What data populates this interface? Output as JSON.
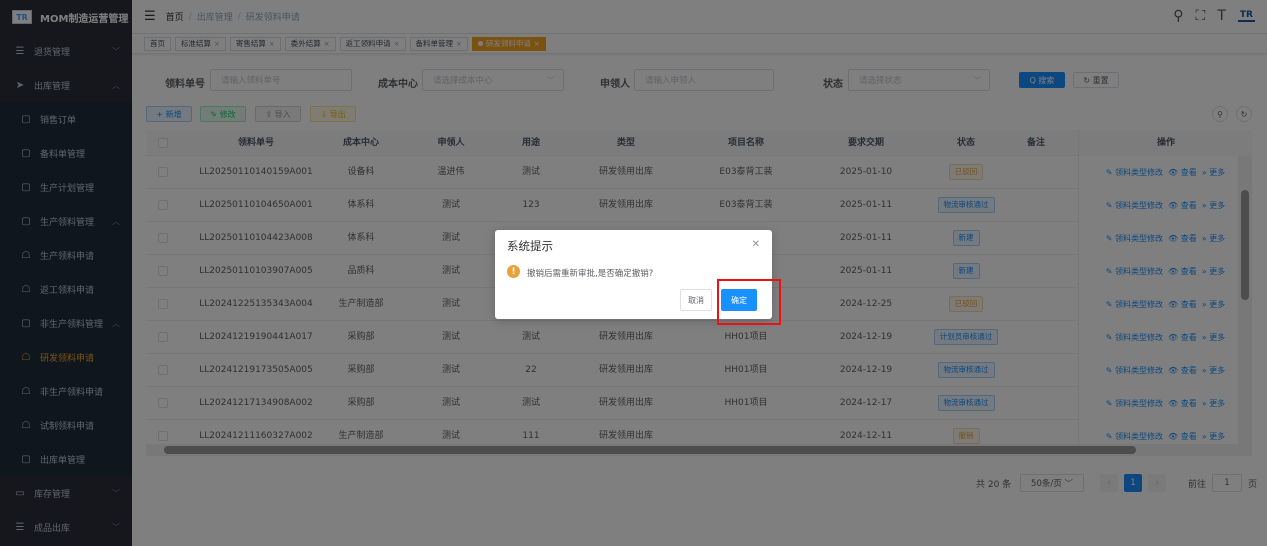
{
  "brand": {
    "logo": "TR",
    "title": "MOM制造运营管理"
  },
  "sidebar": {
    "items": [
      {
        "label": "退货管理",
        "icon": "list-icon",
        "type": "top",
        "chevron": "﹀"
      },
      {
        "label": "出库管理",
        "icon": "send-icon",
        "type": "top-open",
        "chevron": "︿"
      },
      {
        "label": "销售订单",
        "icon": "box-icon",
        "type": "sub"
      },
      {
        "label": "备料单管理",
        "icon": "box-icon",
        "type": "sub"
      },
      {
        "label": "生产计划管理",
        "icon": "box-icon",
        "type": "sub"
      },
      {
        "label": "生产领料管理",
        "icon": "box-icon",
        "type": "sub",
        "chevron": "︿"
      },
      {
        "label": "生产领料申请",
        "icon": "user-icon",
        "type": "sub"
      },
      {
        "label": "返工领料申请",
        "icon": "user-icon",
        "type": "sub"
      },
      {
        "label": "非生产领料管理",
        "icon": "box-icon",
        "type": "sub",
        "chevron": "︿"
      },
      {
        "label": "研发领料申请",
        "icon": "user-icon",
        "type": "sub",
        "active": true
      },
      {
        "label": "非生产领料申请",
        "icon": "user-icon",
        "type": "sub"
      },
      {
        "label": "试制领料申请",
        "icon": "user-icon",
        "type": "sub"
      },
      {
        "label": "出库单管理",
        "icon": "box-icon",
        "type": "sub"
      },
      {
        "label": "库存管理",
        "icon": "monitor-icon",
        "type": "top",
        "chevron": "﹀"
      },
      {
        "label": "成品出库",
        "icon": "list-icon",
        "type": "top",
        "chevron": "﹀"
      }
    ]
  },
  "header": {
    "breadcrumb": [
      "首页",
      "出库管理",
      "研发领料申请"
    ],
    "logo": "TR"
  },
  "tags": [
    {
      "label": "首页",
      "closable": false
    },
    {
      "label": "标准结算",
      "closable": true
    },
    {
      "label": "寄售结算",
      "closable": true
    },
    {
      "label": "委外结算",
      "closable": true
    },
    {
      "label": "返工领料申请",
      "closable": true
    },
    {
      "label": "备料单管理",
      "closable": true
    },
    {
      "label": "研发领料申请",
      "closable": true,
      "active": true
    }
  ],
  "search": {
    "order_label": "领料单号",
    "order_placeholder": "请输入领料单号",
    "cost_label": "成本中心",
    "cost_placeholder": "请选择成本中心",
    "applicant_label": "申领人",
    "applicant_placeholder": "请输入申领人",
    "status_label": "状态",
    "status_placeholder": "请选择状态",
    "search_btn": "Q 搜索",
    "reset_btn": "↻ 重置"
  },
  "toolbar": {
    "add": "+ 新增",
    "edit": "✎ 修改",
    "import": "⇪ 导入",
    "export": "⇩ 导出"
  },
  "table": {
    "columns": [
      "领料单号",
      "成本中心",
      "申领人",
      "用途",
      "类型",
      "项目名称",
      "要求交期",
      "状态",
      "备注",
      "操作"
    ],
    "rows": [
      {
        "no": "LL20250110140159A001",
        "center": "设备科",
        "applicant": "温进伟",
        "usage": "测试",
        "type": "研发领用出库",
        "project": "E03泰背工装",
        "date": "2025-01-10",
        "status": "已驳回",
        "status_color": "yellow"
      },
      {
        "no": "LL20250110104650A001",
        "center": "体系科",
        "applicant": "测试",
        "usage": "123",
        "type": "研发领用出库",
        "project": "E03泰背工装",
        "date": "2025-01-11",
        "status": "物流审核通过",
        "status_color": "blue"
      },
      {
        "no": "LL20250110104423A008",
        "center": "体系科",
        "applicant": "测试",
        "usage": "",
        "type": "",
        "project": "",
        "date": "2025-01-11",
        "status": "新建",
        "status_color": "blue"
      },
      {
        "no": "LL20250110103907A005",
        "center": "品质科",
        "applicant": "测试",
        "usage": "",
        "type": "",
        "project": "",
        "date": "2025-01-11",
        "status": "新建",
        "status_color": "blue"
      },
      {
        "no": "LL20241225135343A004",
        "center": "生产制造部",
        "applicant": "测试",
        "usage": "",
        "type": "",
        "project": "",
        "date": "2024-12-25",
        "status": "已驳回",
        "status_color": "yellow"
      },
      {
        "no": "LL20241219190441A017",
        "center": "采购部",
        "applicant": "测试",
        "usage": "测试",
        "type": "研发领用出库",
        "project": "HH01项目",
        "date": "2024-12-19",
        "status": "计划员审核通过",
        "status_color": "blue"
      },
      {
        "no": "LL20241219173505A005",
        "center": "采购部",
        "applicant": "测试",
        "usage": "22",
        "type": "研发领用出库",
        "project": "HH01项目",
        "date": "2024-12-19",
        "status": "物流审核通过",
        "status_color": "blue"
      },
      {
        "no": "LL20241217134908A002",
        "center": "采购部",
        "applicant": "测试",
        "usage": "测试",
        "type": "研发领用出库",
        "project": "HH01项目",
        "date": "2024-12-17",
        "status": "物流审核通过",
        "status_color": "blue"
      },
      {
        "no": "LL20241211160327A002",
        "center": "生产制造部",
        "applicant": "测试",
        "usage": "111",
        "type": "研发领用出库",
        "project": "",
        "date": "2024-12-11",
        "status": "撤销",
        "status_color": "yellow"
      }
    ],
    "op_type_edit": "✎ 领料类型修改",
    "op_view": "👁 查看",
    "op_more": "» 更多"
  },
  "pager": {
    "total": "共 20 条",
    "size": "50条/页",
    "page": "1",
    "goto_label": "前往",
    "goto_value": "1",
    "page_suffix": "页"
  },
  "dialog": {
    "title": "系统提示",
    "message": "撤销后需重新审批,是否确定撤销?",
    "cancel": "取消",
    "confirm": "确定"
  }
}
